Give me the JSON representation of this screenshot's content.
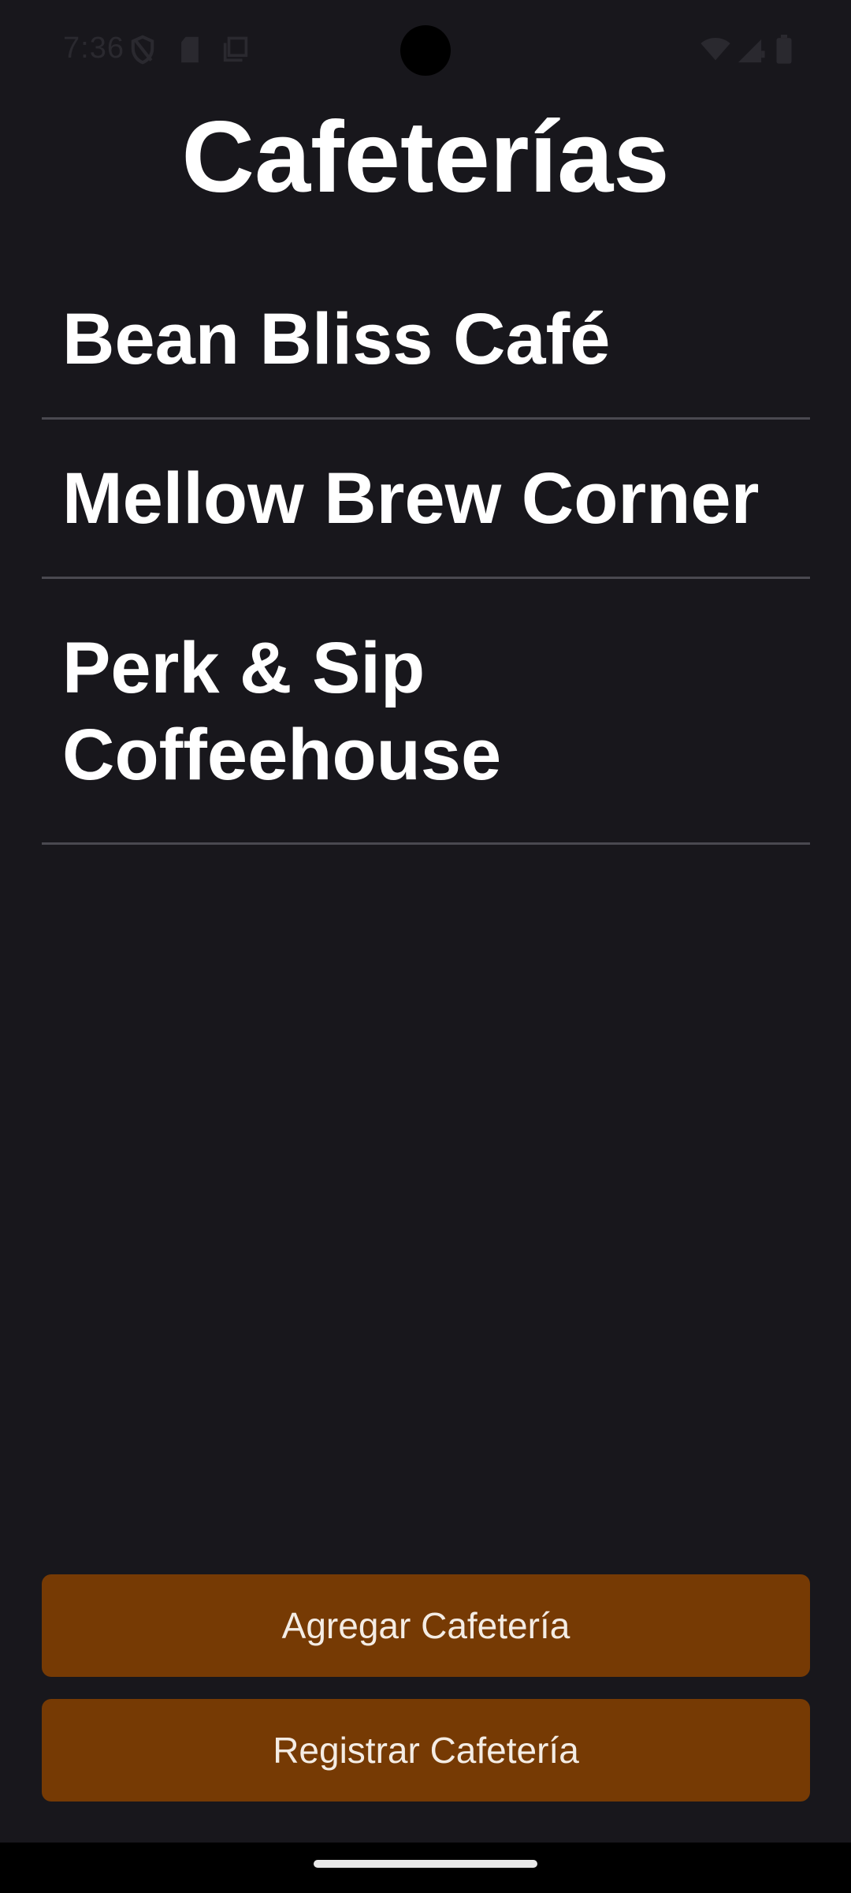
{
  "status_bar": {
    "time": "7:36",
    "icons": [
      "shield-icon",
      "sd-card-icon",
      "screenshot-icon",
      "wifi-icon",
      "cellular-signal-icon",
      "battery-icon"
    ]
  },
  "header": {
    "title": "Cafeterías"
  },
  "cafes": [
    {
      "name": "Bean Bliss Café"
    },
    {
      "name": "Mellow Brew Corner"
    },
    {
      "name": "Perk & Sip Coffeehouse"
    }
  ],
  "actions": {
    "add_label": "Agregar Cafetería",
    "register_label": "Registrar Cafetería"
  },
  "colors": {
    "background": "#18171c",
    "button": "#763a04",
    "divider": "#4a4950"
  }
}
